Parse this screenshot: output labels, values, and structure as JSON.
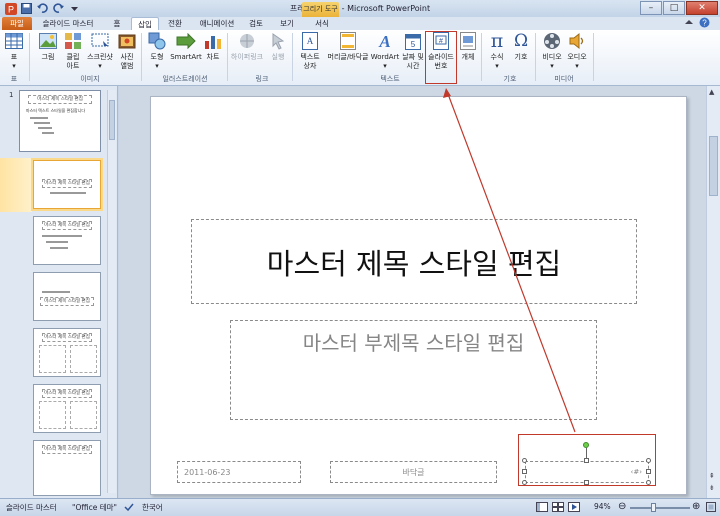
{
  "window": {
    "title": "프레젠테이션1 - Microsoft PowerPoint",
    "contextual_group": "그리기 도구"
  },
  "tabs": {
    "file": "파일",
    "slide_master": "슬라이드 마스터",
    "home": "홈",
    "insert": "삽입",
    "transitions": "전환",
    "animations": "애니메이션",
    "review": "검토",
    "view": "보기",
    "format": "서식"
  },
  "ribbon": {
    "table": "표",
    "picture": "그림",
    "clip_art_1": "클립",
    "clip_art_2": "아트",
    "screenshot": "스크린샷",
    "photo_album_1": "사진",
    "photo_album_2": "앨범",
    "shapes": "도형",
    "smartart": "SmartArt",
    "chart": "차트",
    "hyperlink": "하이퍼링크",
    "action": "실행",
    "textbox_1": "텍스트",
    "textbox_2": "상자",
    "header_footer": "머리글/바닥글",
    "wordart": "WordArt",
    "datetime_1": "날짜 및",
    "datetime_2": "시간",
    "slide_number_1": "슬라이드",
    "slide_number_2": "번호",
    "object": "개체",
    "equation": "수식",
    "symbol": "기호",
    "video": "비디오",
    "audio": "오디오",
    "groups": {
      "tables": "표",
      "images": "이미지",
      "illustrations": "일러스트레이션",
      "links": "링크",
      "text": "텍스트",
      "symbols": "기호",
      "media": "미디어"
    }
  },
  "thumbnails": {
    "first_number": "1",
    "master_title": "마스터 제목 스타일 편집",
    "master_body": "마스터 텍스트 스타일을 편집합니다"
  },
  "slide": {
    "title": "마스터 제목 스타일 편집",
    "subtitle": "마스터 부제목 스타일 편집",
    "date": "2011-06-23",
    "footer": "바닥글",
    "number": "‹#›"
  },
  "status": {
    "view": "슬라이드 마스터",
    "theme": "\"Office 테마\"",
    "language": "한국어",
    "zoom": "94%"
  },
  "colors": {
    "annotation_red": "#c0392b",
    "file_tab": "#c75c16",
    "ribbon_bg": "#e7eef7"
  }
}
